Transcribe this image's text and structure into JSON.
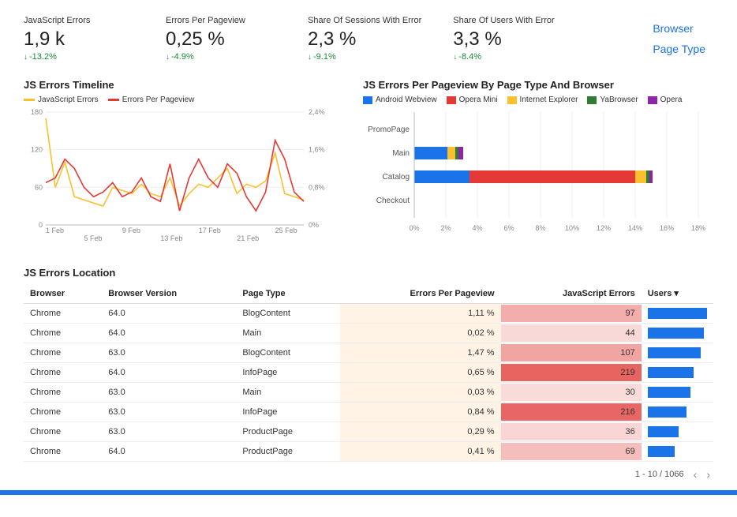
{
  "kpis": [
    {
      "label": "JavaScript Errors",
      "value": "1,9 k",
      "delta": "-13.2%"
    },
    {
      "label": "Errors Per Pageview",
      "value": "0,25 %",
      "delta": "-4.9%"
    },
    {
      "label": "Share Of Sessions With Error",
      "value": "2,3 %",
      "delta": "-9.1%"
    },
    {
      "label": "Share Of Users With Error",
      "value": "3,3 %",
      "delta": "-8.4%"
    }
  ],
  "filters": [
    "Browser",
    "Page Type"
  ],
  "timeline_title": "JS Errors Timeline",
  "timeline_legend": [
    "JavaScript Errors",
    "Errors Per Pageview"
  ],
  "pagetype_title": "JS Errors Per Pageview By Page Type And Browser",
  "pagetype_legend": [
    {
      "name": "Android Webview",
      "color": "#1a73e8"
    },
    {
      "name": "Opera Mini",
      "color": "#e53935"
    },
    {
      "name": "Internet Explorer",
      "color": "#fbc02d"
    },
    {
      "name": "YaBrowser",
      "color": "#2e7d32"
    },
    {
      "name": "Opera",
      "color": "#8e24aa"
    }
  ],
  "location_title": "JS Errors Location",
  "location_headers": [
    "Browser",
    "Browser Version",
    "Page Type",
    "Errors Per Pageview",
    "JavaScript Errors",
    "Users"
  ],
  "location_rows": [
    {
      "browser": "Chrome",
      "version": "64.0",
      "page": "BlogContent",
      "err": "1,11 %",
      "js": 97,
      "heat": 0.44,
      "user_w": 100
    },
    {
      "browser": "Chrome",
      "version": "64.0",
      "page": "Main",
      "err": "0,02 %",
      "js": 44,
      "heat": 0.1,
      "user_w": 95
    },
    {
      "browser": "Chrome",
      "version": "63.0",
      "page": "BlogContent",
      "err": "1,47 %",
      "js": 107,
      "heat": 0.5,
      "user_w": 90
    },
    {
      "browser": "Chrome",
      "version": "64.0",
      "page": "InfoPage",
      "err": "0,65 %",
      "js": 219,
      "heat": 1.0,
      "user_w": 78
    },
    {
      "browser": "Chrome",
      "version": "63.0",
      "page": "Main",
      "err": "0,03 %",
      "js": 30,
      "heat": 0.08,
      "user_w": 72
    },
    {
      "browser": "Chrome",
      "version": "63.0",
      "page": "InfoPage",
      "err": "0,84 %",
      "js": 216,
      "heat": 0.98,
      "user_w": 65
    },
    {
      "browser": "Chrome",
      "version": "63.0",
      "page": "ProductPage",
      "err": "0,29 %",
      "js": 36,
      "heat": 0.12,
      "user_w": 52
    },
    {
      "browser": "Chrome",
      "version": "64.0",
      "page": "ProductPage",
      "err": "0,41 %",
      "js": 69,
      "heat": 0.3,
      "user_w": 45
    }
  ],
  "pager": "1 - 10 / 1066",
  "chart_data": [
    {
      "type": "line",
      "title": "JS Errors Timeline",
      "xlabel": "",
      "ylabel_left": "JavaScript Errors",
      "ylabel_right": "Errors Per Pageview",
      "x_ticks": [
        "1 Feb",
        "5 Feb",
        "9 Feb",
        "13 Feb",
        "17 Feb",
        "21 Feb",
        "25 Feb"
      ],
      "ylim_left": [
        0,
        180
      ],
      "ylim_right": [
        0,
        2.4
      ],
      "x": [
        1,
        2,
        3,
        4,
        5,
        6,
        7,
        8,
        9,
        10,
        11,
        12,
        13,
        14,
        15,
        16,
        17,
        18,
        19,
        20,
        21,
        22,
        23,
        24,
        25,
        26,
        27,
        28
      ],
      "series": [
        {
          "name": "JavaScript Errors",
          "color": "#fbc02d",
          "axis": "left",
          "values": [
            170,
            60,
            100,
            45,
            40,
            35,
            30,
            60,
            55,
            50,
            65,
            50,
            45,
            75,
            30,
            50,
            65,
            60,
            75,
            90,
            50,
            65,
            60,
            70,
            115,
            50,
            45,
            40
          ]
        },
        {
          "name": "Errors Per Pageview",
          "color": "#e53935",
          "axis": "right",
          "values": [
            0.9,
            1.0,
            1.4,
            1.2,
            0.8,
            0.6,
            0.7,
            0.9,
            0.6,
            0.7,
            1.0,
            0.6,
            0.5,
            1.3,
            0.3,
            1.0,
            1.4,
            1.0,
            0.8,
            1.3,
            1.1,
            0.6,
            0.3,
            0.7,
            1.8,
            1.4,
            0.7,
            0.5
          ]
        }
      ]
    },
    {
      "type": "bar",
      "title": "JS Errors Per Pageview By Page Type And Browser",
      "orientation": "horizontal-stacked",
      "xlabel": "%",
      "ylabel": "",
      "xlim": [
        0,
        18
      ],
      "categories": [
        "PromoPage",
        "Main",
        "Catalog",
        "Checkout"
      ],
      "series": [
        {
          "name": "Android Webview",
          "color": "#1a73e8",
          "values": [
            0.0,
            2.1,
            3.5,
            0.0
          ]
        },
        {
          "name": "Opera Mini",
          "color": "#e53935",
          "values": [
            0.0,
            0.0,
            10.5,
            0.0
          ]
        },
        {
          "name": "Internet Explorer",
          "color": "#fbc02d",
          "values": [
            0.0,
            0.5,
            0.7,
            0.0
          ]
        },
        {
          "name": "YaBrowser",
          "color": "#2e7d32",
          "values": [
            0.0,
            0.2,
            0.2,
            0.0
          ]
        },
        {
          "name": "Opera",
          "color": "#8e24aa",
          "values": [
            0.0,
            0.3,
            0.2,
            0.0
          ]
        }
      ]
    }
  ]
}
